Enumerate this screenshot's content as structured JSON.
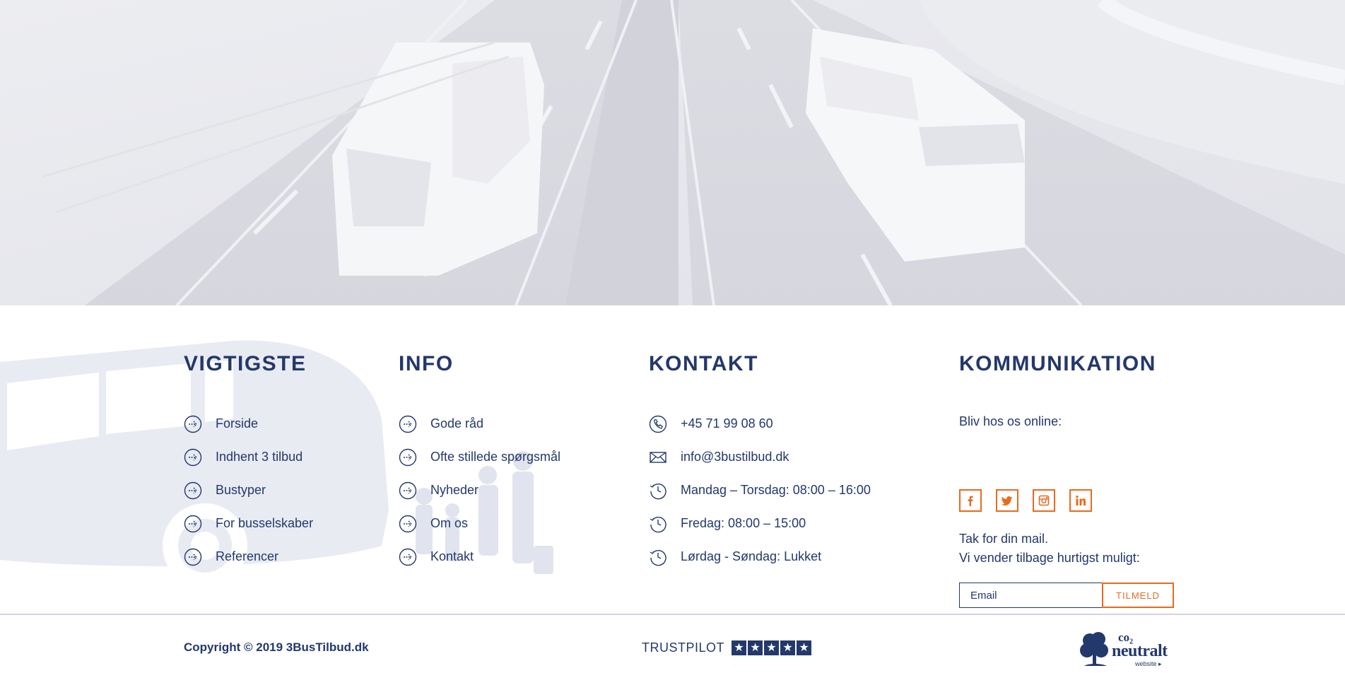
{
  "colors": {
    "navy": "#23386b",
    "orange": "#e96a1e",
    "hero_bg": "#e6e7ec",
    "silhouette": "#e8eaf2"
  },
  "columns": {
    "vigtigste": {
      "title": "VIGTIGSTE",
      "links": [
        "Forside",
        "Indhent 3 tilbud",
        "Bustyper",
        "For busselskaber",
        "Referencer"
      ]
    },
    "info": {
      "title": "INFO",
      "links": [
        "Gode råd",
        "Ofte stillede spørgsmål",
        "Nyheder",
        "Om os",
        "Kontakt"
      ]
    },
    "kontakt": {
      "title": "KONTAKT",
      "items": [
        {
          "icon": "phone-icon",
          "text": "+45 71 99 08 60"
        },
        {
          "icon": "mail-icon",
          "text": "info@3bustilbud.dk"
        },
        {
          "icon": "clock-icon",
          "text": "Mandag – Torsdag: 08:00 – 16:00"
        },
        {
          "icon": "clock-icon",
          "text": "Fredag: 08:00 – 15:00"
        },
        {
          "icon": "clock-icon",
          "text": "Lørdag - Søndag: Lukket"
        }
      ]
    },
    "kommunikation": {
      "title": "KOMMUNIKATION",
      "online_label": "Bliv hos os online:",
      "social": [
        "facebook-icon",
        "twitter-icon",
        "instagram-icon",
        "linkedin-icon"
      ],
      "thanks_line1": "Tak for din mail.",
      "thanks_line2": "Vi vender tilbage hurtigst muligt:",
      "email_placeholder": "Email",
      "subscribe_label": "TILMELD"
    }
  },
  "bottom": {
    "copyright": "Copyright © 2019 3BusTilbud.dk",
    "trustpilot_label": "TRUSTPILOT",
    "trustpilot_stars": 5,
    "co2_line1": "co₂",
    "co2_line2": "neutralt",
    "co2_line3": "website ▸"
  }
}
